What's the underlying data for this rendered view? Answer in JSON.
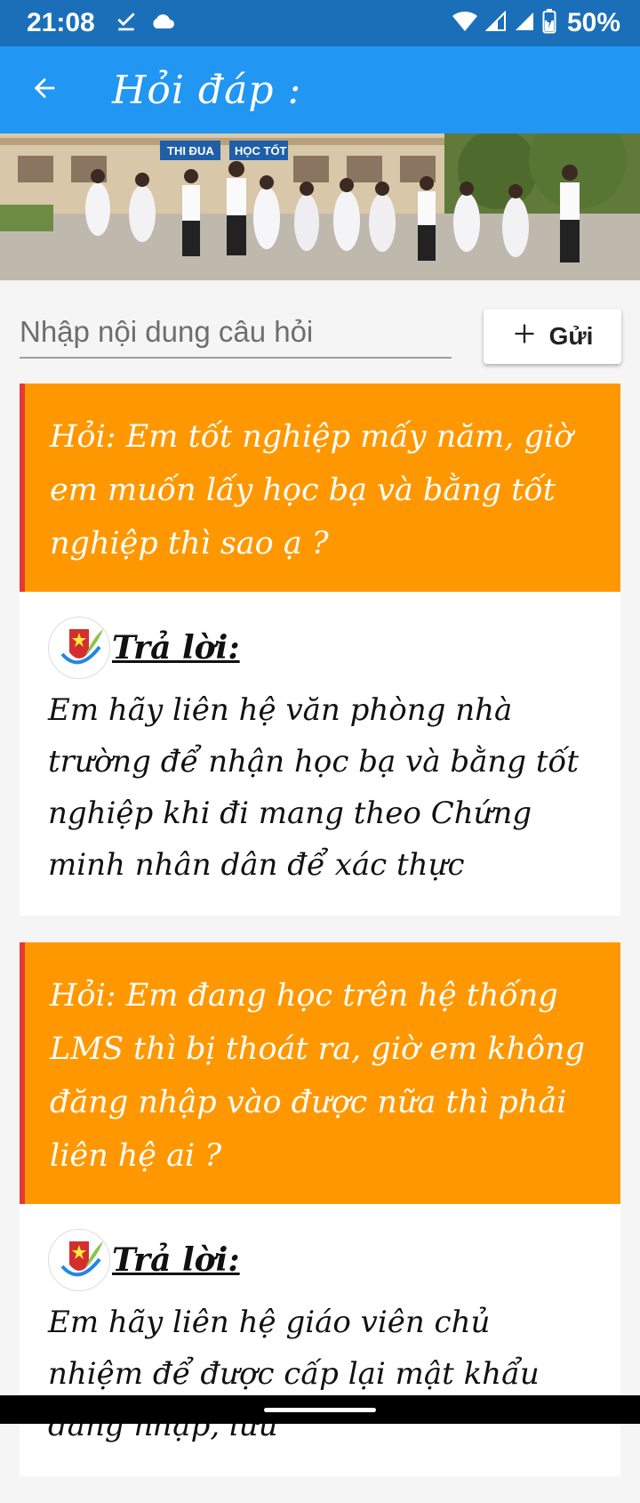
{
  "status_bar": {
    "time": "21:08",
    "battery": "50%",
    "icons": [
      "download-done-icon",
      "cloud-icon",
      "wifi-icon",
      "signal-icon",
      "battery-charging-icon"
    ]
  },
  "app_bar": {
    "title": "Hỏi đáp :",
    "back_icon": "arrow-left-icon",
    "color": "#2196f3"
  },
  "composer": {
    "placeholder": "Nhập nội dung câu hỏi",
    "send_label": "Gửi",
    "send_icon": "plus-icon"
  },
  "qa": [
    {
      "question": "Hỏi: Em tốt nghiệp mấy năm, giờ em muốn lấy học bạ và bằng tốt nghiệp thì sao ạ ?",
      "answer_label": "Trả lời:",
      "answer": "Em hãy liên hệ văn phòng nhà trường để nhận học bạ và bằng tốt nghiệp khi đi mang theo Chứng minh nhân dân để xác thực"
    },
    {
      "question": "Hỏi: Em đang học trên hệ thống LMS thì bị thoát ra, giờ em không đăng nhập vào được nữa thì phải liên hệ ai ?",
      "answer_label": "Trả lời:",
      "answer": "Em hãy liên hệ giáo viên chủ nhiệm để được cấp lại mật khẩu đăng nhập, lưu"
    }
  ],
  "colors": {
    "status_bar": "#1b6fb9",
    "question_bg": "#ff9800",
    "question_accent": "#e53935"
  }
}
